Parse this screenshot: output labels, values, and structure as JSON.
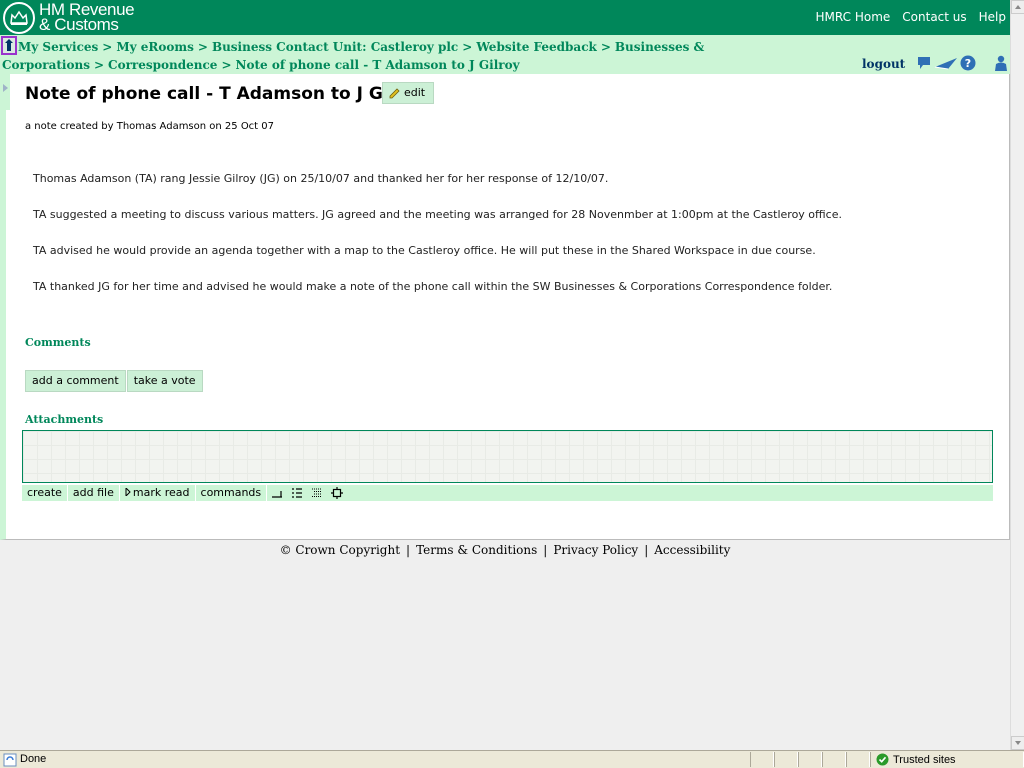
{
  "header": {
    "logo_line1": "HM Revenue",
    "logo_line2": "& Customs",
    "nav": [
      "HMRC Home",
      "Contact us",
      "Help"
    ]
  },
  "breadcrumb": {
    "items": [
      "My Services",
      "My eRooms",
      "Business Contact Unit: Castleroy plc",
      "Website Feedback",
      "Businesses & Corporations",
      "Correspondence",
      "Note of phone call - T Adamson to J Gilroy"
    ],
    "separator": ">",
    "logout": "logout"
  },
  "note": {
    "title": "Note of phone call - T Adamson to J Gilroy",
    "edit_label": "edit",
    "meta": "a note created by Thomas Adamson on 25 Oct 07",
    "paragraphs": [
      "Thomas Adamson (TA) rang Jessie Gilroy (JG) on 25/10/07 and thanked her for her response of 12/10/07.",
      "TA suggested a meeting to discuss various matters. JG agreed and the meeting was arranged for 28 Novenmber at 1:00pm at the Castleroy office.",
      "TA advised he would provide an agenda together with a map to the Castleroy office. He will put these in the Shared Workspace in due course.",
      "TA thanked JG for her time and advised he would make a note of the phone call within the SW Businesses & Corporations Correspondence folder."
    ]
  },
  "comments": {
    "heading": "Comments",
    "add_comment": "add a comment",
    "take_vote": "take a vote"
  },
  "attachments": {
    "heading": "Attachments",
    "toolbar": [
      "create",
      "add file",
      "mark read",
      "commands"
    ]
  },
  "footer": {
    "items": [
      "© Crown Copyright",
      "Terms & Conditions",
      "Privacy Policy",
      "Accessibility"
    ],
    "separator": "|"
  },
  "statusbar": {
    "status": "Done",
    "zone": "Trusted sites"
  },
  "colors": {
    "brand_green": "#00875a",
    "light_green": "#ccf5d6"
  }
}
